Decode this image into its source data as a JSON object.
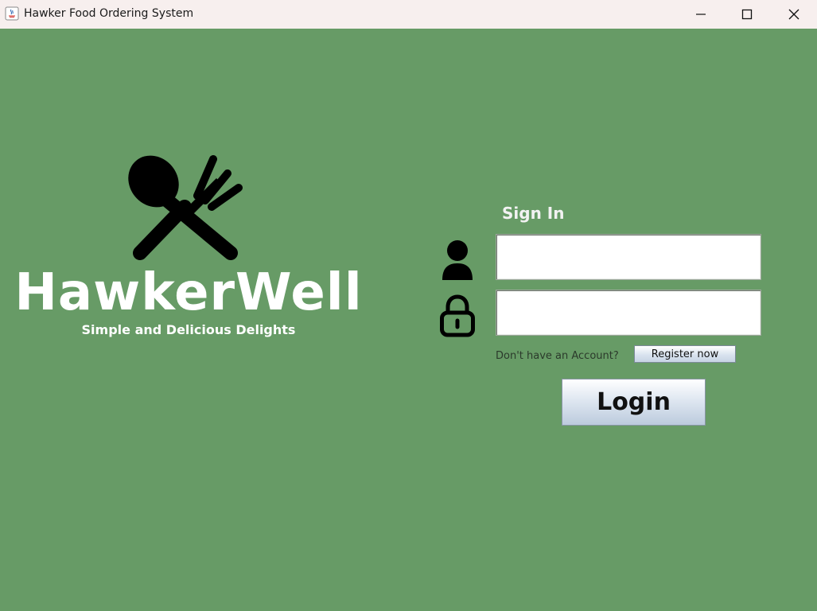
{
  "window": {
    "title": "Hawker Food Ordering System",
    "controls": {
      "minimize": "minimize-icon",
      "maximize": "maximize-icon",
      "close": "close-icon"
    }
  },
  "branding": {
    "logo_icon": "spoon-fork-crossed-icon",
    "name": "HawkerWell",
    "tagline": "Simple and Delicious Delights"
  },
  "signin": {
    "title": "Sign In",
    "username_icon": "user-icon",
    "username_value": "",
    "password_icon": "lock-icon",
    "password_value": "",
    "no_account_text": "Don't have an Account?",
    "register_label": "Register now",
    "login_label": "Login"
  },
  "colors": {
    "background": "#679b66",
    "titlebar": "#f7efee",
    "text_light": "#ffffff"
  }
}
